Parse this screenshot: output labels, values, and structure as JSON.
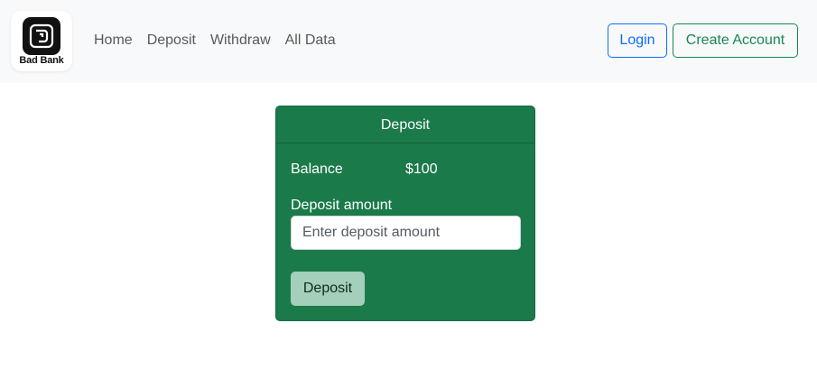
{
  "brand": {
    "name": "Bad Bank",
    "icon": "bank-logo-icon"
  },
  "nav": {
    "links": [
      "Home",
      "Deposit",
      "Withdraw",
      "All Data"
    ]
  },
  "auth": {
    "login_label": "Login",
    "create_label": "Create Account"
  },
  "colors": {
    "login": "#0d6efd",
    "create": "#198754",
    "card": "#1b7a4a",
    "button": "#a3cfbb"
  },
  "card": {
    "title": "Deposit",
    "balance_label": "Balance",
    "balance_value": "$100",
    "amount_label": "Deposit amount",
    "amount_placeholder": "Enter deposit amount",
    "amount_value": "",
    "submit_label": "Deposit"
  }
}
